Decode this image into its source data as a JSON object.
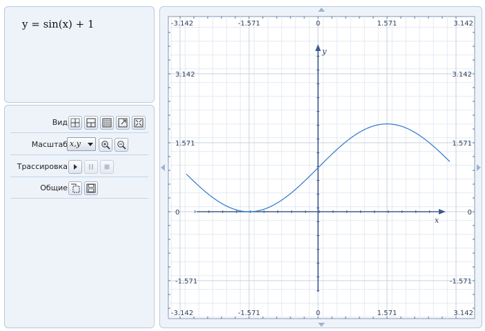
{
  "formula": "y = sin(x) + 1",
  "controls": {
    "view_label": "Вид",
    "scale_label": "Масштаб",
    "scale_value": "x,y",
    "trace_label": "Трассировка",
    "general_label": "Общие"
  },
  "chart_data": {
    "type": "line",
    "function": "y = sin(x) + 1",
    "xlabel": "x",
    "ylabel": "y",
    "xlim": [
      -3.142,
      3.142
    ],
    "ylim": [
      -1.571,
      3.142
    ],
    "x_ticks": [
      "-3.142",
      "-1.571",
      "0",
      "1.571",
      "3.142"
    ],
    "y_ticks": [
      "3.142",
      "1.571",
      "0",
      "-1.571"
    ],
    "grid": true,
    "series": [
      {
        "color": "#3a7fcf",
        "x": [
          -3.0,
          -2.5,
          -2.0,
          -1.571,
          -1.0,
          -0.5,
          0,
          0.5,
          1.0,
          1.571,
          2.0,
          2.5,
          3.0
        ],
        "y": [
          0.859,
          0.402,
          0.091,
          0.0,
          0.159,
          0.521,
          1.0,
          1.479,
          1.841,
          2.0,
          1.909,
          1.598,
          1.141
        ]
      }
    ]
  }
}
